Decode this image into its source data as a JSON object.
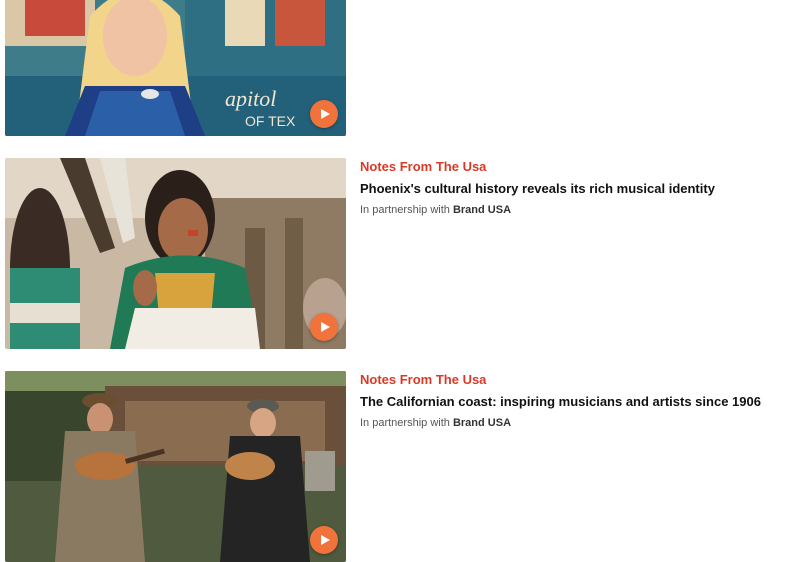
{
  "articles": [
    {
      "category": "",
      "title": "",
      "partner_prefix": "",
      "partner_name": "",
      "thumbnail_icon": "play-icon"
    },
    {
      "category": "Notes From The Usa",
      "title": "Phoenix's cultural history reveals its rich musical identity",
      "partner_prefix": "In partnership with",
      "partner_name": "Brand USA",
      "thumbnail_icon": "play-icon"
    },
    {
      "category": "Notes From The Usa",
      "title": "The Californian coast: inspiring musicians and artists since 1906",
      "partner_prefix": "In partnership with",
      "partner_name": "Brand USA",
      "thumbnail_icon": "play-icon"
    }
  ],
  "colors": {
    "accent": "#d93a26",
    "play_button": "#f0733b"
  }
}
